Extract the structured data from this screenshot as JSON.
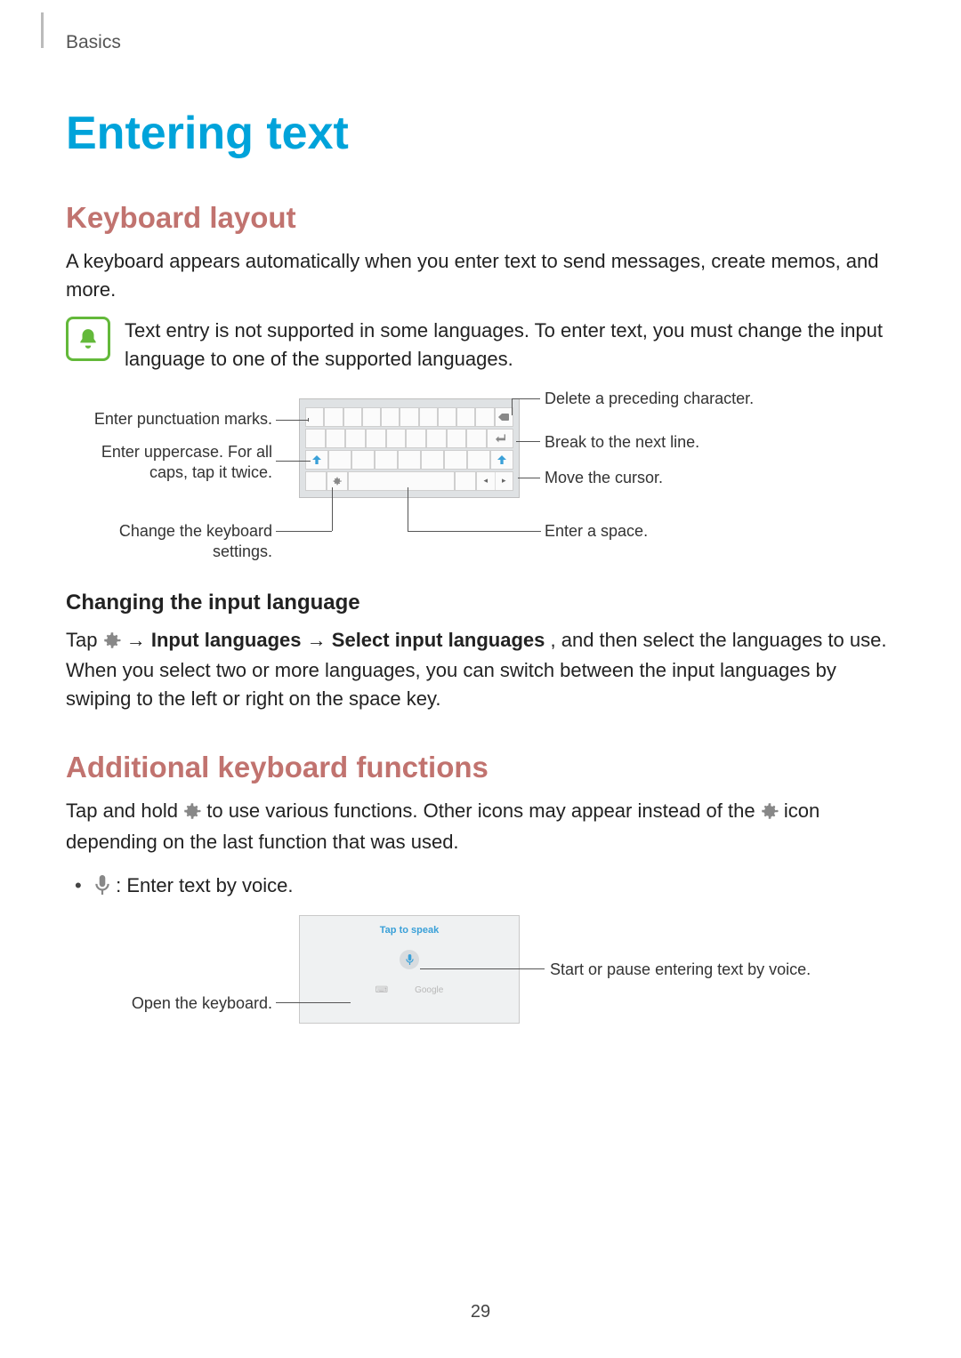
{
  "header": {
    "section": "Basics"
  },
  "title": "Entering text",
  "h2_keyboard": "Keyboard layout",
  "p_keyboard_intro": "A keyboard appears automatically when you enter text to send messages, create memos, and more.",
  "notice_text": "Text entry is not supported in some languages. To enter text, you must change the input language to one of the supported languages.",
  "diagram": {
    "left": {
      "punctuation": "Enter punctuation marks.",
      "uppercase": "Enter uppercase. For all caps, tap it twice.",
      "settings": "Change the keyboard settings."
    },
    "right": {
      "delete": "Delete a preceding character.",
      "newline": "Break to the next line.",
      "cursor": "Move the cursor.",
      "space": "Enter a space."
    }
  },
  "h3_change_lang": "Changing the input language",
  "change_lang": {
    "pre": "Tap ",
    "arrow1": " → ",
    "b1": "Input languages",
    "arrow2": " → ",
    "b2": "Select input languages",
    "post": ", and then select the languages to use. When you select two or more languages, you can switch between the input languages by swiping to the left or right on the space key."
  },
  "h2_additional": "Additional keyboard functions",
  "additional": {
    "pre": "Tap and hold ",
    "mid": " to use various functions. Other icons may appear instead of the ",
    "post": " icon depending on the last function that was used."
  },
  "bullet_voice": " : Enter text by voice.",
  "voice_panel": {
    "tap": "Tap to speak",
    "google": "Google"
  },
  "voice_diagram": {
    "open_kb": "Open the keyboard.",
    "start_pause": "Start or pause entering text by voice."
  },
  "page_number": "29"
}
